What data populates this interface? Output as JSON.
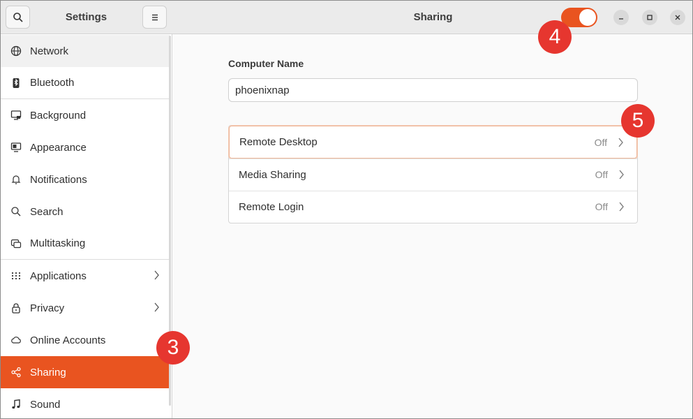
{
  "sidebar": {
    "title": "Settings",
    "items": [
      {
        "label": "Network",
        "icon": "globe-icon"
      },
      {
        "label": "Bluetooth",
        "icon": "bluetooth-icon"
      },
      {
        "label": "Background",
        "icon": "monitor-icon"
      },
      {
        "label": "Appearance",
        "icon": "appearance-icon"
      },
      {
        "label": "Notifications",
        "icon": "bell-icon"
      },
      {
        "label": "Search",
        "icon": "search-icon"
      },
      {
        "label": "Multitasking",
        "icon": "multitasking-icon"
      },
      {
        "label": "Applications",
        "icon": "apps-grid-icon"
      },
      {
        "label": "Privacy",
        "icon": "lock-icon"
      },
      {
        "label": "Online Accounts",
        "icon": "cloud-icon"
      },
      {
        "label": "Sharing",
        "icon": "share-icon"
      },
      {
        "label": "Sound",
        "icon": "music-note-icon"
      }
    ]
  },
  "header": {
    "title": "Sharing",
    "sharing_enabled": true
  },
  "content": {
    "computer_name_label": "Computer Name",
    "computer_name_value": "phoenixnap",
    "rows": [
      {
        "label": "Remote Desktop",
        "state": "Off"
      },
      {
        "label": "Media Sharing",
        "state": "Off"
      },
      {
        "label": "Remote Login",
        "state": "Off"
      }
    ]
  },
  "badges": {
    "b3": "3",
    "b4": "4",
    "b5": "5"
  },
  "colors": {
    "accent": "#e95420",
    "badge": "#e6362f"
  }
}
